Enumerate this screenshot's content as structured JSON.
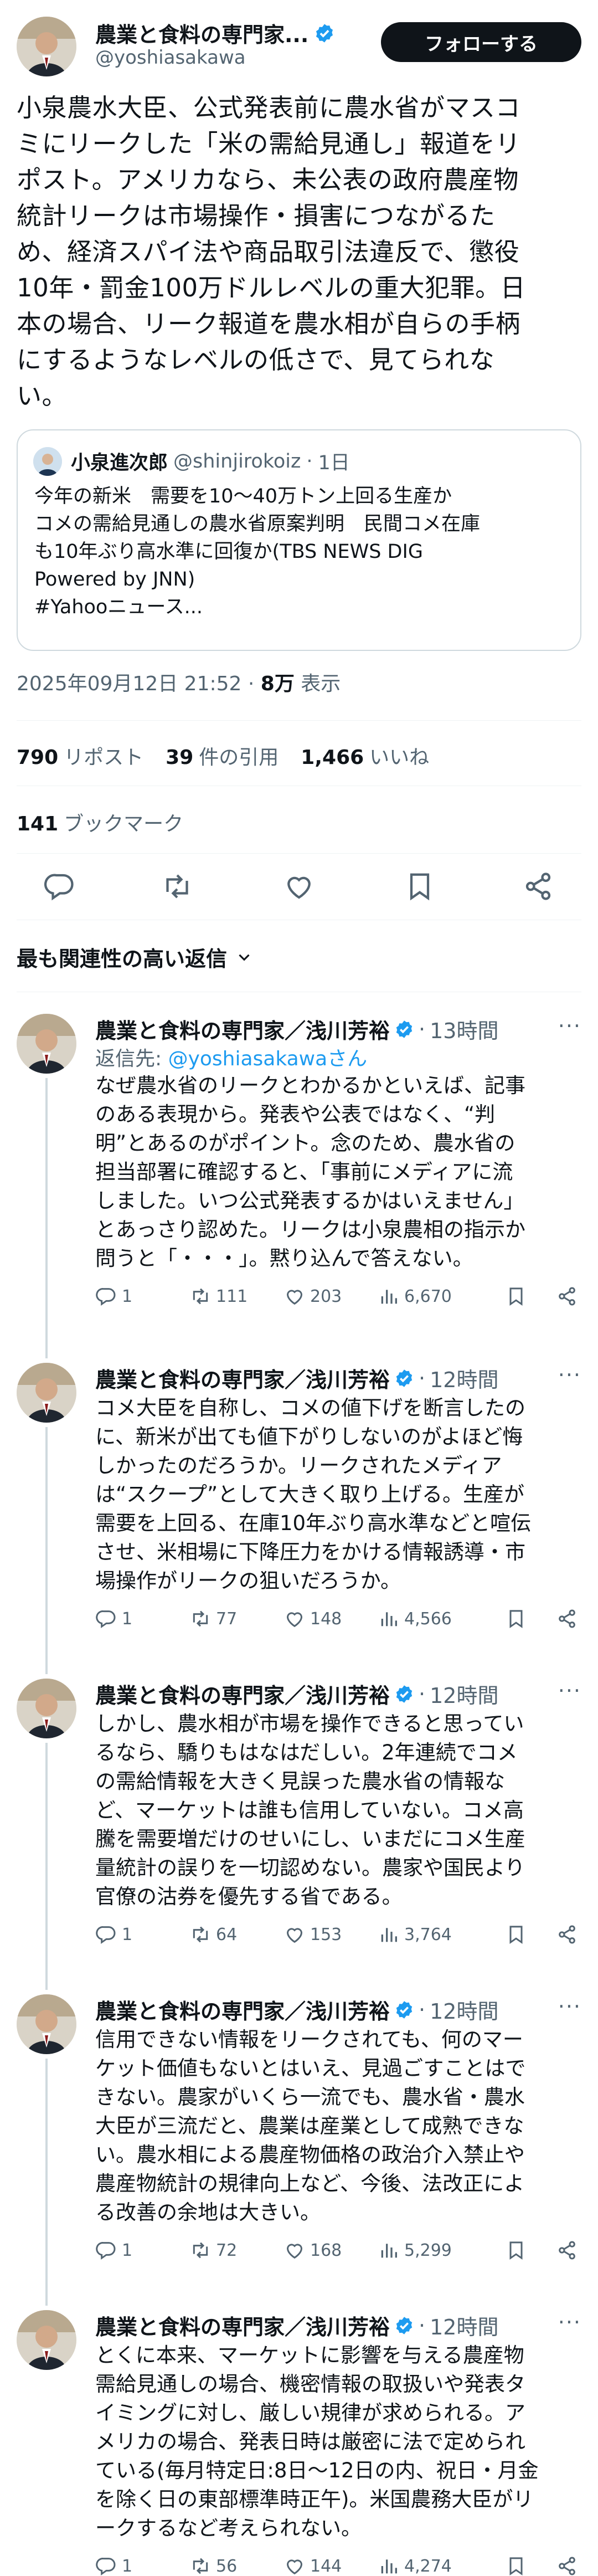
{
  "author": {
    "name": "農業と食料の専門家...",
    "handle": "@yoshiasakawa"
  },
  "follow_label": "フォローする",
  "main_text": "小泉農水大臣、公式発表前に農水省がマスコ\nミにリークした「米の需給見通し」報道をリ\nポスト。アメリカなら、未公表の政府農産物\n統計リークは市場操作・損害につながるた\nめ、経済スパイ法や商品取引法違反で、懲役\n10年・罰金100万ドルレベルの重大犯罪。日\n本の場合、リーク報道を農水相が自らの手柄\nにするようなレベルの低さで、見てられな\nい。",
  "quote": {
    "name": "小泉進次郎",
    "handle": "@shinjirokoiz",
    "time": "1日",
    "text": "今年の新米　需要を10～40万トン上回る生産か\nコメの需給見通しの農水省原案判明　民間コメ在庫\nも10年ぶり高水準に回復か(TBS NEWS DIG\nPowered by JNN)\n#Yahooニュース..."
  },
  "meta": {
    "datetime": "2025年09月12日 21:52",
    "views_value": "8万",
    "views_label": "表示"
  },
  "stats": {
    "reposts_value": "790",
    "reposts_label": "リポスト",
    "quotes_value": "39",
    "quotes_label": "件の引用",
    "likes_value": "1,466",
    "likes_label": "いいね",
    "bookmarks_value": "141",
    "bookmarks_label": "ブックマーク"
  },
  "relevance_label": "最も関連性の高い返信",
  "replies": [
    {
      "name": "農業と食料の専門家／浅川芳裕",
      "time": "13時間",
      "reply_to_prefix": "返信先: ",
      "reply_to_handle": "@yoshiasakawaさん",
      "text": "なぜ農水省のリークとわかるかといえば、記事\nのある表現から。発表や公表ではなく、“判\n明”とあるのがポイント。念のため、農水省の\n担当部署に確認すると、「事前にメディアに流\nしました。いつ公式発表するかはいえません」\nとあっさり認めた。リークは小泉農相の指示か\n問うと「・・・」。黙り込んで答えない。",
      "replies": "1",
      "reposts": "111",
      "likes": "203",
      "views": "6,670"
    },
    {
      "name": "農業と食料の専門家／浅川芳裕",
      "time": "12時間",
      "text": "コメ大臣を自称し、コメの値下げを断言したの\nに、新米が出ても値下がりしないのがよほど悔\nしかったのだろうか。リークされたメディア\nは“スクープ”として大きく取り上げる。生産が\n需要を上回る、在庫10年ぶり高水準などと喧伝\nさせ、米相場に下降圧力をかける情報誘導・市\n場操作がリークの狙いだろうか。",
      "replies": "1",
      "reposts": "77",
      "likes": "148",
      "views": "4,566"
    },
    {
      "name": "農業と食料の専門家／浅川芳裕",
      "time": "12時間",
      "text": "しかし、農水相が市場を操作できると思ってい\nるなら、驕りもはなはだしい。2年連続でコメ\nの需給情報を大きく見誤った農水省の情報な\nど、マーケットは誰も信用していない。コメ高\n騰を需要増だけのせいにし、いまだにコメ生産\n量統計の誤りを一切認めない。農家や国民より\n官僚の沽券を優先する省である。",
      "replies": "1",
      "reposts": "64",
      "likes": "153",
      "views": "3,764"
    },
    {
      "name": "農業と食料の専門家／浅川芳裕",
      "time": "12時間",
      "text": "信用できない情報をリークされても、何のマー\nケット価値もないとはいえ、見過ごすことはで\nきない。農家がいくら一流でも、農水省・農水\n大臣が三流だと、農業は産業として成熟できな\nい。農水相による農産物価格の政治介入禁止や\n農産物統計の規律向上など、今後、法改正によ\nる改善の余地は大きい。",
      "replies": "1",
      "reposts": "72",
      "likes": "168",
      "views": "5,299"
    },
    {
      "name": "農業と食料の専門家／浅川芳裕",
      "time": "12時間",
      "text": "とくに本来、マーケットに影響を与える農産物\n需給見通しの場合、機密情報の取扱いや発表タ\nイミングに対し、厳しい規律が求められる。ア\nメリカの場合、発表日時は厳密に法で定められ\nている(毎月特定日:8日～12日の内、祝日・月金\nを除く日の東部標準時正午)。米国農務大臣がリ\nークするなど考えられない。",
      "replies": "1",
      "reposts": "56",
      "likes": "144",
      "views": "4,274"
    }
  ],
  "icons": {
    "verified": "verified-badge-icon",
    "reply": "reply-icon",
    "repost": "repost-icon",
    "like": "like-icon",
    "bookmark": "bookmark-icon",
    "share": "share-icon",
    "views": "views-icon",
    "chevron": "chevron-down-icon"
  },
  "colors": {
    "accent": "#1d9bf0",
    "text": "#0f1419",
    "secondary": "#536471",
    "border": "#cfd9de"
  }
}
